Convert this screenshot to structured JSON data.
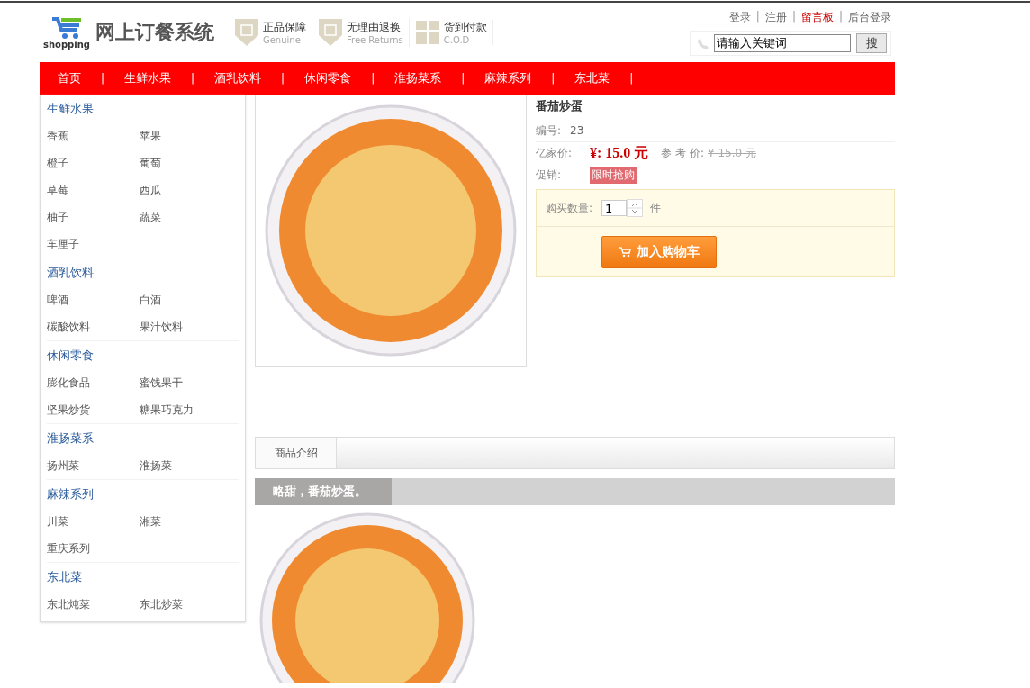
{
  "logo": {
    "caption": "shopping",
    "title": "网上订餐系统"
  },
  "badges": [
    {
      "kind": "shield",
      "title": "正品保障",
      "subtitle": "Genuine"
    },
    {
      "kind": "shield",
      "title": "无理由退换",
      "subtitle": "Free Returns"
    },
    {
      "kind": "box",
      "title": "货到付款",
      "subtitle": "C.O.D"
    }
  ],
  "top_links": {
    "separator": "|",
    "items": [
      {
        "label": "登录",
        "highlighted": false
      },
      {
        "label": "注册",
        "highlighted": false
      },
      {
        "label": "留言板",
        "highlighted": true
      },
      {
        "label": "后台登录",
        "highlighted": false
      }
    ]
  },
  "search": {
    "value": "请输入关键词",
    "button": "搜"
  },
  "nav": {
    "separator": "|",
    "items": [
      "首页",
      "生鲜水果",
      "酒乳饮料",
      "休闲零食",
      "淮扬菜系",
      "麻辣系列",
      "东北菜"
    ]
  },
  "sidebar": [
    {
      "title": "生鲜水果",
      "items": [
        "香蕉",
        "苹果",
        "橙子",
        "葡萄",
        "草莓",
        "西瓜",
        "柚子",
        "蔬菜",
        "车厘子"
      ]
    },
    {
      "title": "酒乳饮料",
      "items": [
        "啤酒",
        "白酒",
        "碳酸饮料",
        "果汁饮料"
      ]
    },
    {
      "title": "休闲零食",
      "items": [
        "膨化食品",
        "蜜饯果干",
        "坚果炒货",
        "糖果巧克力"
      ]
    },
    {
      "title": "淮扬菜系",
      "items": [
        "扬州菜",
        "淮扬菜"
      ]
    },
    {
      "title": "麻辣系列",
      "items": [
        "川菜",
        "湘菜",
        "重庆系列"
      ]
    },
    {
      "title": "东北菜",
      "items": [
        "东北炖菜",
        "东北炒菜"
      ]
    }
  ],
  "product": {
    "name": "番茄炒蛋",
    "id_label": "编号:",
    "id": "23",
    "price_label": "亿家价:",
    "price": "¥: 15.0 元",
    "ref_label": "参 考 价:",
    "ref_price": "¥ 15.0 元",
    "promo_label": "促销:",
    "promo": "限时抢购",
    "qty_label": "购买数量:",
    "qty": "1",
    "unit": "件",
    "cart_button": "加入购物车"
  },
  "tabs": [
    {
      "label": "商品介绍",
      "selected": true
    }
  ],
  "description": "略甜，番茄炒蛋。"
}
